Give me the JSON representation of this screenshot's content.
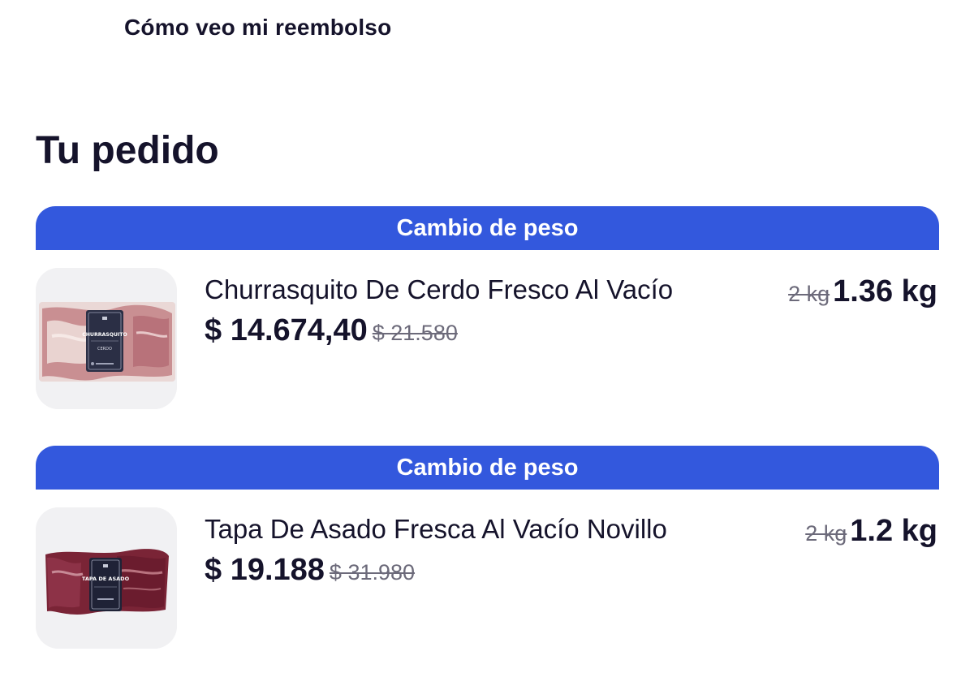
{
  "header": {
    "refund_link": "Cómo veo mi reembolso"
  },
  "order": {
    "title": "Tu pedido",
    "items": [
      {
        "banner": "Cambio de peso",
        "name": "Churrasquito De Cerdo Fresco Al Vacío",
        "price": "$ 14.674,40",
        "original_price": "$ 21.580",
        "old_weight": "2 kg",
        "new_weight": "1.36 kg",
        "package_label": "CHURRASQUITO",
        "package_sublabel": "CERDO",
        "icon": "pork-pack-image"
      },
      {
        "banner": "Cambio de peso",
        "name": "Tapa De Asado Fresca Al Vacío Novillo",
        "price": "$ 19.188",
        "original_price": "$ 31.980",
        "old_weight": "2 kg",
        "new_weight": "1.2 kg",
        "package_label": "TAPA DE ASADO",
        "icon": "beef-pack-image"
      }
    ]
  },
  "colors": {
    "banner": "#3358dd",
    "text": "#15132b",
    "muted": "#6c6a7a",
    "thumb_bg": "#f1f1f3"
  }
}
